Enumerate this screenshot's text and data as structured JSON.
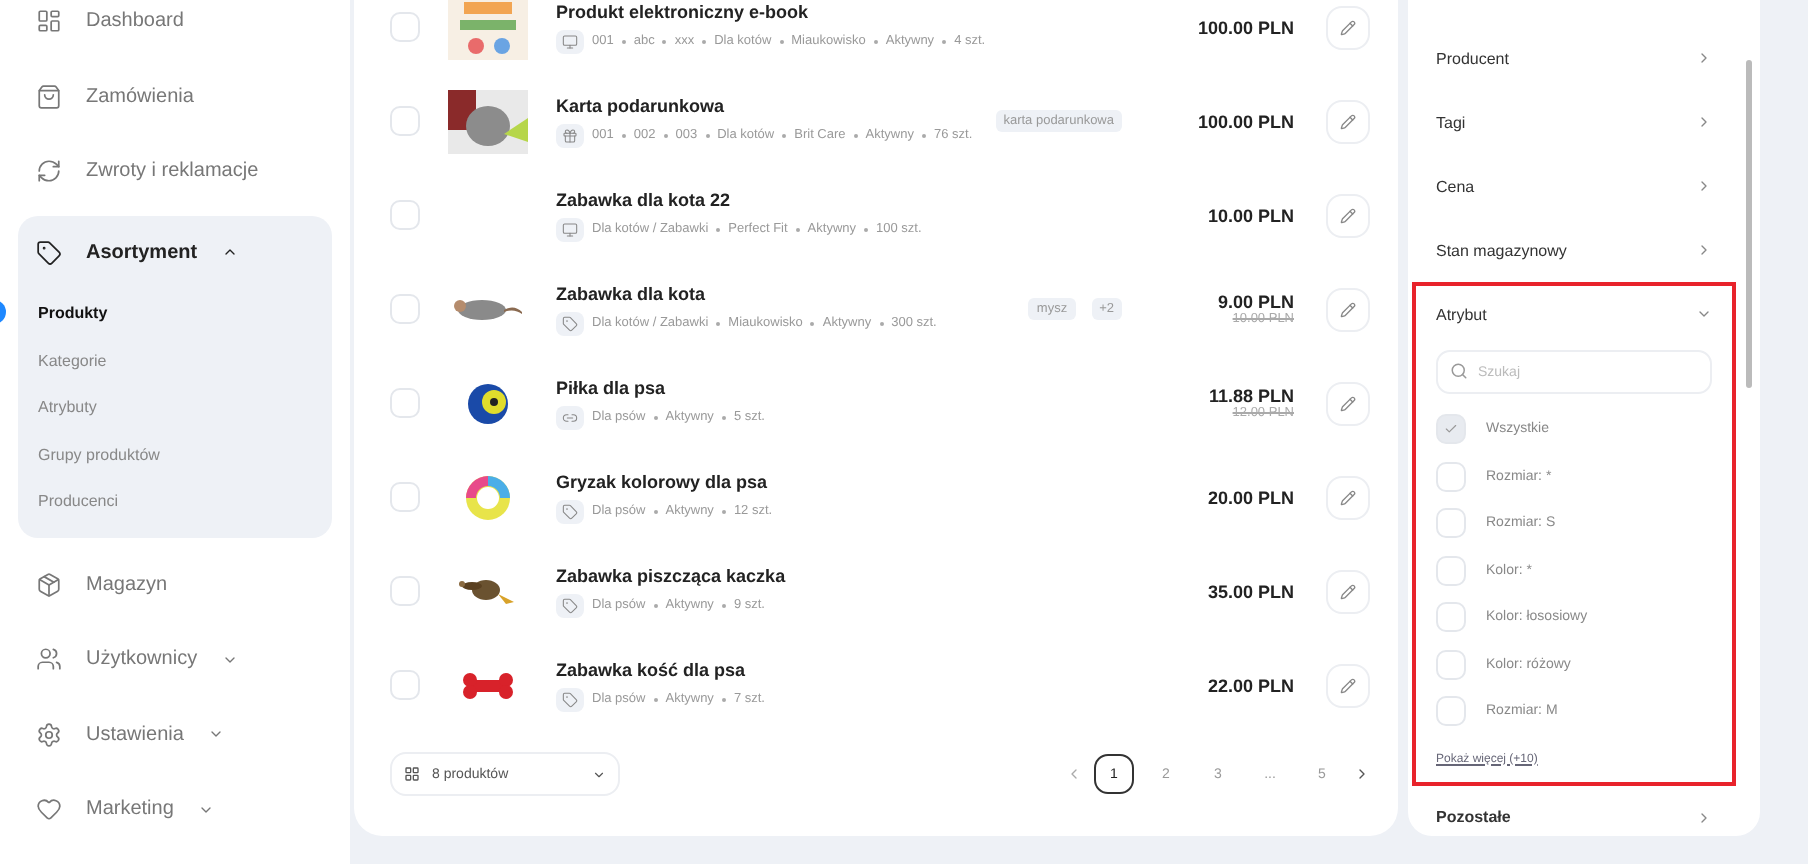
{
  "sidebar": {
    "items": [
      {
        "label": "Dashboard",
        "kind": "dashboard"
      },
      {
        "label": "Zamówienia",
        "kind": "orders"
      },
      {
        "label": "Zwroty i reklamacje",
        "kind": "returns"
      },
      {
        "label": "Asortyment",
        "kind": "catalog",
        "expanded": true,
        "children": [
          {
            "label": "Produkty",
            "selected": true
          },
          {
            "label": "Kategorie",
            "selected": false
          },
          {
            "label": "Atrybuty",
            "selected": false
          },
          {
            "label": "Grupy produktów",
            "selected": false
          },
          {
            "label": "Producenci",
            "selected": false
          }
        ]
      },
      {
        "label": "Magazyn",
        "kind": "warehouse"
      },
      {
        "label": "Użytkownicy",
        "kind": "users",
        "expanded": false
      },
      {
        "label": "Ustawienia",
        "kind": "settings",
        "expanded": false
      },
      {
        "label": "Marketing",
        "kind": "marketing",
        "expanded": false
      }
    ]
  },
  "products": [
    {
      "name": "Produkt elektroniczny e-book",
      "checked": false,
      "kind": "digital",
      "thumbnail": {
        "kind": "picture"
      },
      "meta": [
        "001",
        "abc",
        "xxx",
        "Dla kotów",
        "Miaukowisko",
        "Aktywny",
        "4 szt."
      ],
      "price": "100.00 PLN"
    },
    {
      "name": "Karta podarunkowa",
      "checked": false,
      "kind": "gift",
      "thumbnail": {
        "kind": "picture"
      },
      "meta": [
        "001",
        "002",
        "003",
        "Dla kotów",
        "Brit Care",
        "Aktywny",
        "76 szt."
      ],
      "tags": [
        "karta podarunkowa"
      ],
      "price": "100.00 PLN"
    },
    {
      "name": "Zabawka dla kota 22",
      "checked": false,
      "kind": "digital",
      "meta": [
        "Dla kotów / Zabawki",
        "Perfect Fit",
        "Aktywny",
        "100 szt."
      ],
      "price": "10.00 PLN"
    },
    {
      "name": "Zabawka dla kota",
      "checked": false,
      "kind": "physical",
      "thumbnail": {
        "kind": "picture"
      },
      "meta": [
        "Dla kotów / Zabawki",
        "Miaukowisko",
        "Aktywny",
        "300 szt."
      ],
      "tags": [
        "mysz",
        "+2"
      ],
      "price": "9.00 PLN",
      "old_price": "10.00 PLN"
    },
    {
      "name": "Piłka dla psa",
      "checked": false,
      "kind": "linked",
      "thumbnail": {
        "kind": "picture"
      },
      "meta": [
        "Dla psów",
        "Aktywny",
        "5 szt."
      ],
      "price": "11.88 PLN",
      "old_price": "12.00 PLN"
    },
    {
      "name": "Gryzak kolorowy dla psa",
      "checked": false,
      "kind": "physical",
      "thumbnail": {
        "kind": "picture"
      },
      "meta": [
        "Dla psów",
        "Aktywny",
        "12 szt."
      ],
      "price": "20.00 PLN"
    },
    {
      "name": "Zabawka piszcząca kaczka",
      "checked": false,
      "kind": "physical",
      "thumbnail": {
        "kind": "picture"
      },
      "meta": [
        "Dla psów",
        "Aktywny",
        "9 szt."
      ],
      "price": "35.00 PLN"
    },
    {
      "name": "Zabawka kość dla psa",
      "checked": false,
      "kind": "physical",
      "thumbnail": {
        "kind": "picture"
      },
      "meta": [
        "Dla psów",
        "Aktywny",
        "7 szt."
      ],
      "price": "22.00 PLN"
    }
  ],
  "footer": {
    "page_size": "8 produktów",
    "pages": [
      {
        "label": "1",
        "selected": true
      },
      {
        "label": "2",
        "selected": false
      },
      {
        "label": "3",
        "selected": false
      },
      {
        "label": "...",
        "selected": false
      },
      {
        "label": "5",
        "selected": false
      }
    ]
  },
  "filters": {
    "sections": [
      {
        "title": "Producent",
        "expanded": false
      },
      {
        "title": "Tagi",
        "expanded": false
      },
      {
        "title": "Cena",
        "expanded": false
      },
      {
        "title": "Stan magazynowy",
        "expanded": false
      },
      {
        "title": "Atrybut",
        "expanded": true,
        "highlighted": true,
        "search_placeholder": "Szukaj",
        "options": [
          {
            "label": "Wszystkie",
            "checked": true
          },
          {
            "label": "Rozmiar: *",
            "checked": false
          },
          {
            "label": "Rozmiar: S",
            "checked": false
          },
          {
            "label": "Kolor: *",
            "checked": false
          },
          {
            "label": "Kolor: łososiowy",
            "checked": false
          },
          {
            "label": "Kolor: różowy",
            "checked": false
          },
          {
            "label": "Rozmiar: M",
            "checked": false
          }
        ],
        "more": "Pokaż więcej (+10)"
      },
      {
        "title": "Pozostałe",
        "expanded": false,
        "highlighted": false
      }
    ]
  }
}
